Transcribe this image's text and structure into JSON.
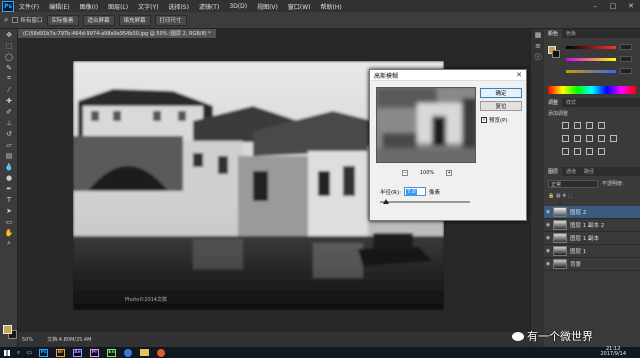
{
  "app": {
    "logo": "Ps"
  },
  "menubar": {
    "items": [
      "文件(F)",
      "编辑(E)",
      "图像(I)",
      "图层(L)",
      "文字(Y)",
      "选择(S)",
      "滤镜(T)",
      "3D(D)",
      "视图(V)",
      "窗口(W)",
      "帮助(H)"
    ]
  },
  "optionsbar": {
    "check_label": "所有窗口",
    "buttons": [
      "实际像素",
      "适合屏幕",
      "填充屏幕",
      "打印尺寸"
    ]
  },
  "document": {
    "tab_label": "(C)58d91b7a-797b-464d-9974-a98a9a954b30.jpg @ 50% (图层 2, RGB/8) *",
    "watermark": "Photo©2014文赋"
  },
  "statusbar": {
    "zoom": "50%",
    "doc_info": "文档:4.80M/25.4M"
  },
  "dialog": {
    "title": "高斯模糊",
    "ok_label": "确定",
    "reset_label": "复位",
    "preview_label": "预览(P)",
    "preview_checked": "✓",
    "zoom_value": "100%",
    "radius_label": "半径(R):",
    "radius_value": "7.0",
    "radius_unit": "像素",
    "radius_fraction": 0.07
  },
  "panels": {
    "color_tabs": [
      "颜色",
      "色板"
    ],
    "adjust_tabs": [
      "调整",
      "样式"
    ],
    "adjust_label": "添加调整",
    "layers_tabs": [
      "图层",
      "通道",
      "路径"
    ],
    "blend_mode": "正常",
    "opacity_label": "不透明度:",
    "layers": [
      {
        "name": "图层 2",
        "selected": true
      },
      {
        "name": "图层 1 副本 2",
        "selected": false
      },
      {
        "name": "图层 1 副本",
        "selected": false
      },
      {
        "name": "图层 1",
        "selected": false
      },
      {
        "name": "背景",
        "selected": false
      }
    ]
  },
  "taskbar": {
    "apps": [
      "Ps",
      "Br",
      "Ae",
      "Pr",
      "En"
    ],
    "time": "21:12",
    "date": "2017/9/14"
  },
  "brand": {
    "text": "有一个微世界"
  },
  "colors": {
    "fg": "#c9a74a",
    "bg": "#1a1a1a",
    "selected_layer": "#3b5a80"
  }
}
